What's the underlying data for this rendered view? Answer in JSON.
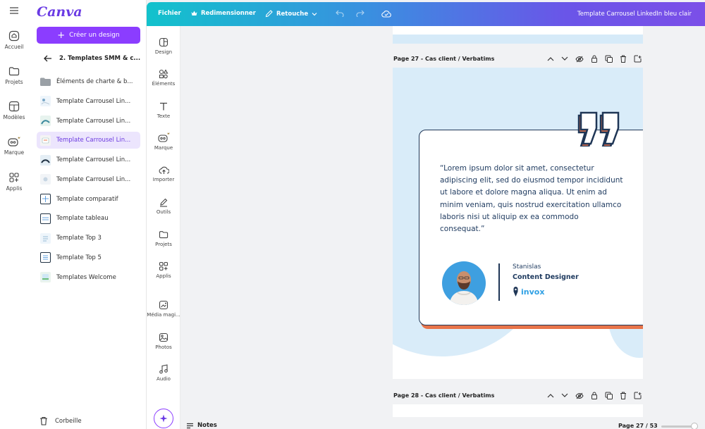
{
  "rail": {
    "items": [
      {
        "label": "Accueil",
        "icon": "home-icon"
      },
      {
        "label": "Projets",
        "icon": "folder-icon"
      },
      {
        "label": "Modèles",
        "icon": "templates-icon"
      },
      {
        "label": "Marque",
        "icon": "brand-icon"
      },
      {
        "label": "Applis",
        "icon": "apps-icon"
      }
    ]
  },
  "panel": {
    "logo": "Canva",
    "create_label": "Créer un design",
    "breadcrumb": "2. Templates SMM & c...",
    "items": [
      {
        "label": "Éléments de charte & b...",
        "icon": "folder-icon"
      },
      {
        "label": "Template Carrousel Lin...",
        "icon": "template-thumb"
      },
      {
        "label": "Template Carrousel Lin...",
        "icon": "template-thumb"
      },
      {
        "label": "Template Carrousel Lin...",
        "icon": "template-thumb",
        "active": true
      },
      {
        "label": "Template Carrousel Lin...",
        "icon": "template-thumb"
      },
      {
        "label": "Template Carrousel Lin...",
        "icon": "template-thumb"
      },
      {
        "label": "Template comparatif",
        "icon": "template-thumb"
      },
      {
        "label": "Template tableau",
        "icon": "template-thumb"
      },
      {
        "label": "Template Top 3",
        "icon": "template-thumb"
      },
      {
        "label": "Template Top 5",
        "icon": "template-thumb"
      },
      {
        "label": "Templates Welcome",
        "icon": "template-thumb"
      }
    ],
    "trash_label": "Corbeille"
  },
  "topbar": {
    "file": "Fichier",
    "resize": "Redimensionner",
    "edit": "Retouche",
    "doc_title": "Template Carrousel LinkedIn bleu clair"
  },
  "tools": [
    {
      "label": "Design",
      "icon": "design-icon"
    },
    {
      "label": "Éléments",
      "icon": "elements-icon"
    },
    {
      "label": "Texte",
      "icon": "text-icon"
    },
    {
      "label": "Marque",
      "icon": "brand-icon"
    },
    {
      "label": "Importer",
      "icon": "upload-icon"
    },
    {
      "label": "Outils",
      "icon": "tools-icon"
    },
    {
      "label": "Projets",
      "icon": "folder-icon"
    },
    {
      "label": "Applis",
      "icon": "apps-icon"
    },
    {
      "label": "Média magi...",
      "icon": "magic-media-icon"
    },
    {
      "label": "Photos",
      "icon": "photos-icon"
    },
    {
      "label": "Audio",
      "icon": "audio-icon"
    }
  ],
  "canvas": {
    "page_27_label": "Page 27 - Cas client / Verbatims",
    "page_28_label": "Page 28 - Cas client / Verbatims",
    "quote": "“Lorem ipsum dolor sit amet, consectetur adipiscing elit, sed do eiusmod tempor incididunt ut labore et dolore magna aliqua. Ut enim ad minim veniam, quis nostrud exercitation ullamco laboris nisi ut aliquip ex ea commodo consequat.”",
    "author": "Stanislas",
    "role": "Content Designer",
    "brand": "invox",
    "colors": {
      "navy": "#1f3656",
      "orange": "#e8744a",
      "light_blue": "#d9ecf9",
      "brand_blue": "#2fa0e4"
    }
  },
  "footer": {
    "notes": "Notes",
    "pager": "Page 27 / 53"
  }
}
